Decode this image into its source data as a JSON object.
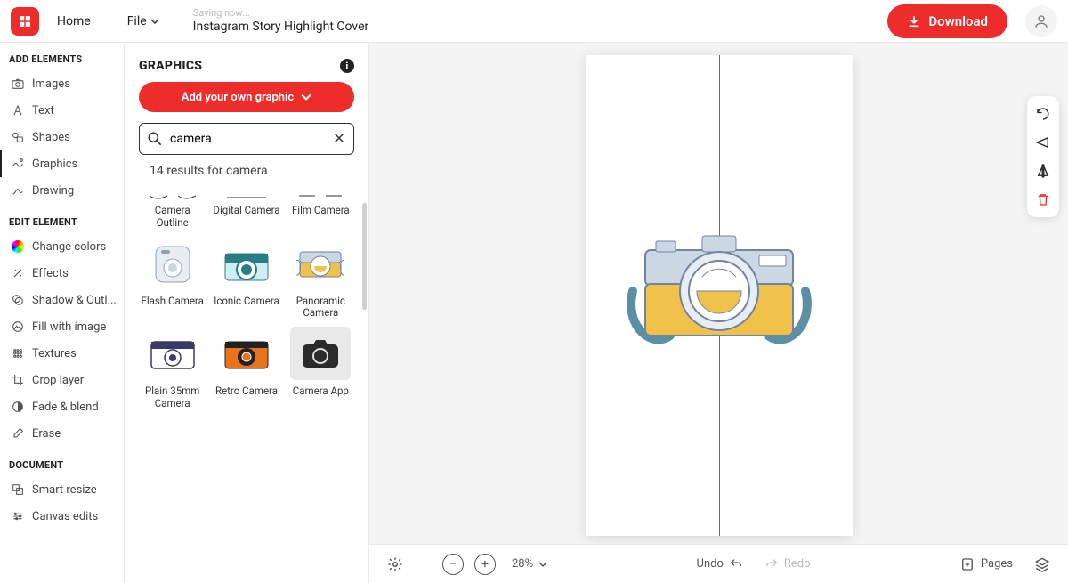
{
  "topbar": {
    "home": "Home",
    "file": "File",
    "status": "Saving now...",
    "title": "Instagram Story Highlight Cover",
    "download": "Download"
  },
  "sidebar": {
    "section_add": "ADD ELEMENTS",
    "add_items": [
      {
        "label": "Images",
        "icon": "camera-icon"
      },
      {
        "label": "Text",
        "icon": "text-icon"
      },
      {
        "label": "Shapes",
        "icon": "shapes-icon"
      },
      {
        "label": "Graphics",
        "icon": "graphic-icon",
        "active": true
      },
      {
        "label": "Drawing",
        "icon": "drawing-icon"
      }
    ],
    "section_edit": "EDIT ELEMENT",
    "edit_items": [
      {
        "label": "Change colors",
        "icon": "color-wheel-icon"
      },
      {
        "label": "Effects",
        "icon": "effects-icon"
      },
      {
        "label": "Shadow & Outl...",
        "icon": "shadow-icon"
      },
      {
        "label": "Fill with image",
        "icon": "fill-image-icon"
      },
      {
        "label": "Textures",
        "icon": "textures-icon"
      },
      {
        "label": "Crop layer",
        "icon": "crop-icon"
      },
      {
        "label": "Fade & blend",
        "icon": "fade-icon"
      },
      {
        "label": "Erase",
        "icon": "erase-icon"
      }
    ],
    "section_doc": "DOCUMENT",
    "doc_items": [
      {
        "label": "Smart resize",
        "icon": "smart-resize-icon"
      },
      {
        "label": "Canvas edits",
        "icon": "canvas-edits-icon"
      }
    ]
  },
  "panel": {
    "heading": "GRAPHICS",
    "add_own": "Add your own graphic",
    "search_value": "camera",
    "results_text": "14 results for camera",
    "items": [
      {
        "label": "Camera Outline"
      },
      {
        "label": "Digital Camera"
      },
      {
        "label": "Film Camera"
      },
      {
        "label": "Flash Camera"
      },
      {
        "label": "Iconic Camera"
      },
      {
        "label": "Panoramic Camera"
      },
      {
        "label": "Plain 35mm Camera"
      },
      {
        "label": "Retro Camera"
      },
      {
        "label": "Camera App",
        "selected": true
      }
    ]
  },
  "bottombar": {
    "zoom": "28%",
    "undo": "Undo",
    "redo": "Redo",
    "pages": "Pages"
  },
  "colors": {
    "accent": "#ed2c2c"
  }
}
